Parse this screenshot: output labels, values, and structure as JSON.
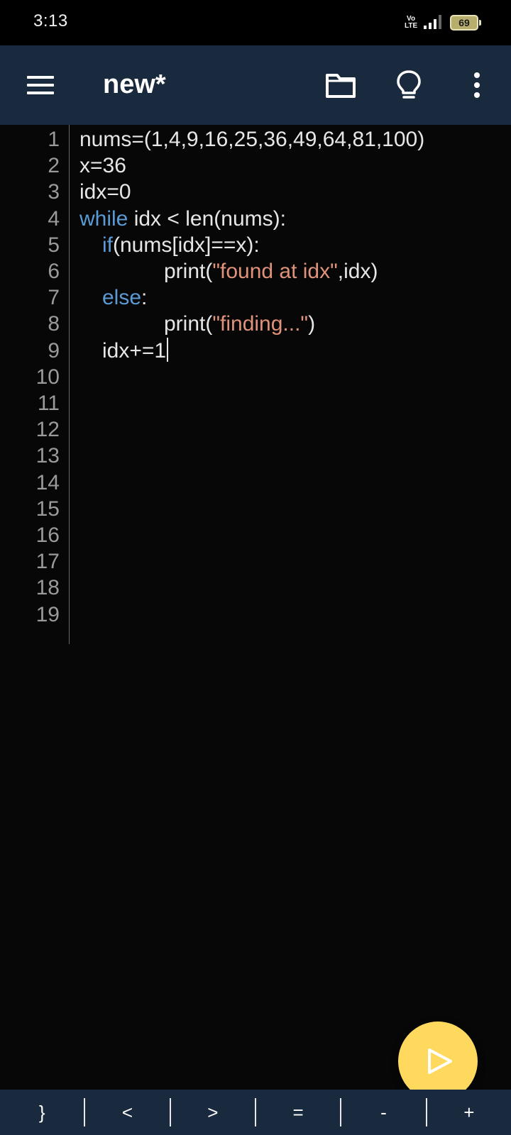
{
  "status_bar": {
    "time": "3:13",
    "network": "Vo LTE",
    "battery": "69"
  },
  "toolbar": {
    "title": "new*",
    "icons": [
      "menu-icon",
      "folder-icon",
      "lightbulb-icon",
      "more-vertical-icon"
    ]
  },
  "editor": {
    "line_numbers": [
      "1",
      "2",
      "3",
      "4",
      "5",
      "6",
      "7",
      "8",
      "9",
      "10",
      "11",
      "12",
      "13",
      "14",
      "15",
      "16",
      "17",
      "18",
      "19"
    ],
    "lines": [
      [
        {
          "t": "nums=(1,4,9,16,25,36,49,64,81,100)",
          "c": "plain"
        }
      ],
      [
        {
          "t": "x=36",
          "c": "plain"
        }
      ],
      [
        {
          "t": "idx=0",
          "c": "plain"
        }
      ],
      [
        {
          "t": "while",
          "c": "keyword"
        },
        {
          "t": " idx < len(nums):",
          "c": "plain"
        }
      ],
      [
        {
          "t": "if",
          "c": "keyword"
        },
        {
          "t": "(nums[idx]==x):",
          "c": "plain"
        }
      ],
      [
        {
          "t": "print(",
          "c": "plain"
        },
        {
          "t": "\"found at idx\"",
          "c": "string"
        },
        {
          "t": ",idx)",
          "c": "plain"
        }
      ],
      [
        {
          "t": "else",
          "c": "keyword"
        },
        {
          "t": ":",
          "c": "plain"
        }
      ],
      [
        {
          "t": "print(",
          "c": "plain"
        },
        {
          "t": "\"finding...\"",
          "c": "string"
        },
        {
          "t": ")",
          "c": "plain"
        }
      ],
      [
        {
          "t": "idx+=1",
          "c": "plain"
        }
      ]
    ],
    "indent_levels": [
      0,
      0,
      0,
      0,
      1,
      2,
      1,
      2,
      1
    ],
    "cursor_line": 9,
    "colors": {
      "keyword": "#5b9bd5",
      "string": "#e0927a",
      "plain": "#e6e6e6"
    }
  },
  "run_button": {
    "icon": "play-icon",
    "color": "#ffd95e"
  },
  "keybar": {
    "keys": [
      "}",
      "<",
      ">",
      "=",
      "-",
      "+"
    ]
  }
}
